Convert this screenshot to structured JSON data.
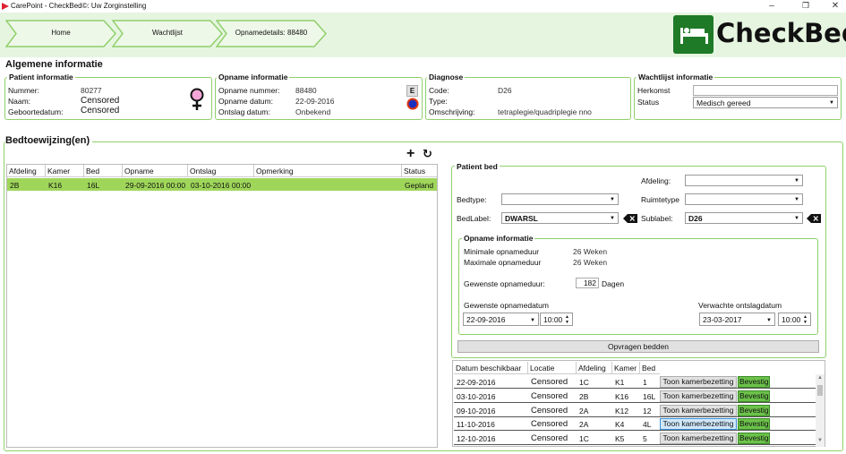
{
  "window": {
    "title": "CarePoint - CheckBed©: Uw Zorginstelling"
  },
  "breadcrumb": [
    "Home",
    "Wachtlijst",
    "Opnamedetails: 88480"
  ],
  "logo": {
    "text": "CheckBed",
    "color": "#1e7a27"
  },
  "algemene": {
    "title": "Algemene informatie",
    "patient": {
      "title": "Patient informatie",
      "nummer_label": "Nummer:",
      "nummer": "80277",
      "naam_label": "Naam:",
      "naam": "Censored",
      "geboorte_label": "Geboortedatum:",
      "geboorte": "Censored",
      "gender_icon": "female-symbol-icon"
    },
    "opname": {
      "title": "Opname informatie",
      "nummer_label": "Opname nummer:",
      "nummer": "88480",
      "datum_label": "Opname datum:",
      "datum": "22-09-2016",
      "ontslag_label": "Ontslag datum:",
      "ontslag": "Onbekend",
      "e_button": "E"
    },
    "diagnose": {
      "title": "Diagnose",
      "code_label": "Code:",
      "code": "D26",
      "type_label": "Type:",
      "type": "",
      "omschrijving_label": "Omschrijving:",
      "omschrijving": "tetraplegie/quadriplegie nno"
    },
    "wachtlijst": {
      "title": "Wachtlijst informatie",
      "herkomst_label": "Herkomst",
      "herkomst": "",
      "status_label": "Status",
      "status": "Medisch gereed"
    }
  },
  "bedtoewijzing": {
    "title": "Bedtoewijzing(en)",
    "columns": [
      "Afdeling",
      "Kamer",
      "Bed",
      "Opname",
      "Ontslag",
      "Opmerking",
      "Status"
    ],
    "rows": [
      [
        "2B",
        "K16",
        "16L",
        "29-09-2016 00:00",
        "03-10-2016 00:00",
        "",
        "Gepland"
      ]
    ]
  },
  "patient_bed": {
    "title": "Patient bed",
    "afdeling_label": "Afdeling:",
    "afdeling": "",
    "bedtype_label": "Bedtype:",
    "bedtype": "",
    "ruimtetype_label": "Ruimtetype",
    "ruimtetype": "",
    "bedlabel_label": "BedLabel:",
    "bedlabel": "DWARSL",
    "sublabel_label": "Sublabel:",
    "sublabel": "D26",
    "opname_info": {
      "title": "Opname informatie",
      "min_label": "Minimale opnameduur",
      "min": "26 Weken",
      "max_label": "Maximale opnameduur",
      "max": "26 Weken",
      "gewenste_duur_label": "Gewenste opnameduur:",
      "gewenste_duur": "182",
      "duur_unit": "Dagen",
      "gewenste_datum_label": "Gewenste opnamedatum",
      "gewenste_datum": "22-09-2016",
      "gewenste_tijd": "10:00",
      "verwachte_label": "Verwachte ontslagdatum",
      "verwachte_datum": "23-03-2017",
      "verwachte_tijd": "10:00"
    },
    "opvragen_button": "Opvragen bedden"
  },
  "availability": {
    "columns": [
      "Datum beschikbaar",
      "Locatie",
      "Afdeling",
      "Kamer",
      "Bed"
    ],
    "toon_label": "Toon kamerbezetting",
    "bevestig_label": "Bevestig",
    "rows": [
      {
        "datum": "22-09-2016",
        "locatie": "Censored",
        "afdeling": "1C",
        "kamer": "K1",
        "bed": "1"
      },
      {
        "datum": "03-10-2016",
        "locatie": "Censored",
        "afdeling": "2B",
        "kamer": "K16",
        "bed": "16L"
      },
      {
        "datum": "09-10-2016",
        "locatie": "Censored",
        "afdeling": "2A",
        "kamer": "K12",
        "bed": "12"
      },
      {
        "datum": "11-10-2016",
        "locatie": "Censored",
        "afdeling": "2A",
        "kamer": "K4",
        "bed": "4L"
      },
      {
        "datum": "12-10-2016",
        "locatie": "Censored",
        "afdeling": "1C",
        "kamer": "K5",
        "bed": "5"
      }
    ]
  }
}
